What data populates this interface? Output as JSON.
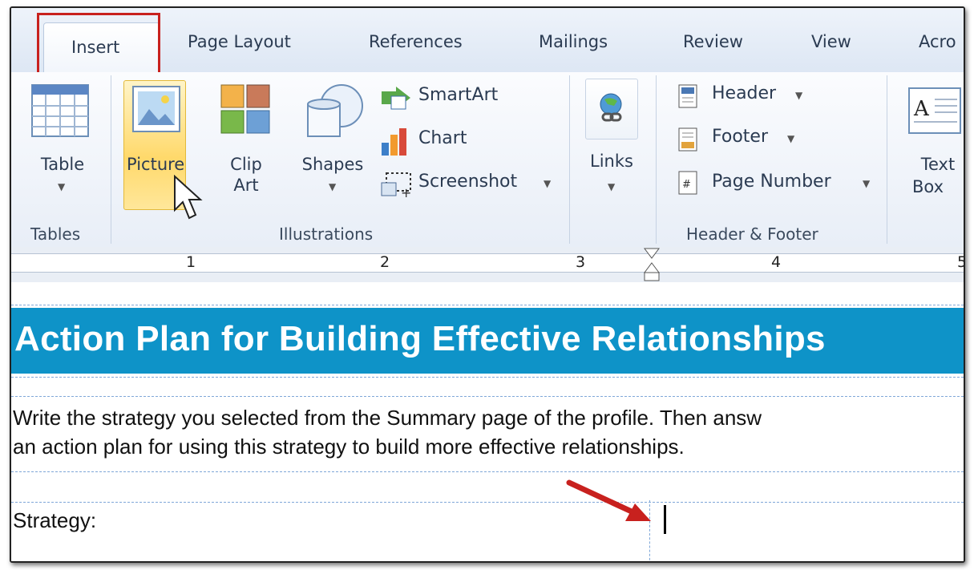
{
  "tabs": [
    "Insert",
    "Page Layout",
    "References",
    "Mailings",
    "Review",
    "View",
    "Acro"
  ],
  "ribbon": {
    "tables_group": {
      "table_label": "Table",
      "group_label": "Tables"
    },
    "illustrations_group": {
      "picture_label": "Picture",
      "clip_art_label_1": "Clip",
      "clip_art_label_2": "Art",
      "shapes_label": "Shapes",
      "smartart_label": "SmartArt",
      "chart_label": "Chart",
      "screenshot_label": "Screenshot",
      "group_label": "Illustrations"
    },
    "links_group": {
      "links_label": "Links"
    },
    "header_footer_group": {
      "header_label": "Header",
      "footer_label": "Footer",
      "page_number_label": "Page Number",
      "group_label": "Header & Footer"
    },
    "text_group": {
      "text_box_label_1": "Text",
      "text_box_label_2": "Box"
    }
  },
  "ruler": {
    "marks": [
      "1",
      "2",
      "3",
      "4",
      "5"
    ]
  },
  "document": {
    "banner_title": "Action Plan for Building Effective Relationships",
    "instructions_line_1": "Write the strategy you selected from the Summary page of the profile. Then answ",
    "instructions_line_2": "an action plan for using this strategy to build more effective relationships.",
    "strategy_label": "Strategy:"
  },
  "colors": {
    "banner": "#0e93c8",
    "highlight_box": "#c8211e",
    "arrow": "#c8211e"
  }
}
